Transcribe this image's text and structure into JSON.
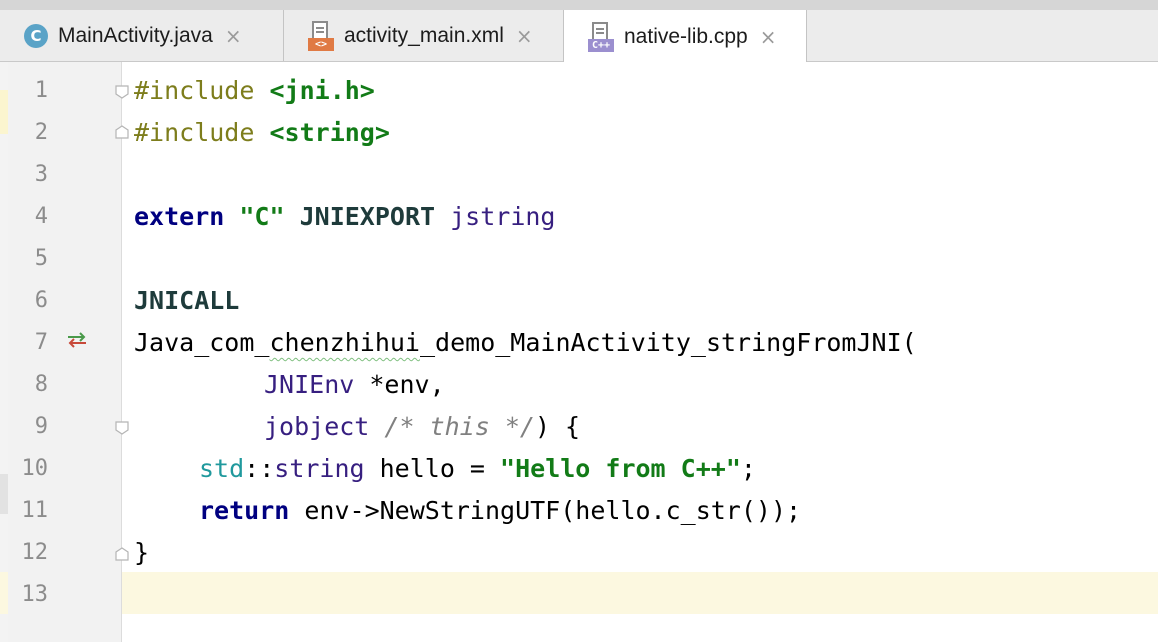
{
  "tabs": [
    {
      "label": "MainActivity.java",
      "icon": "java-class-icon",
      "icon_letter": "C",
      "active": false
    },
    {
      "label": "activity_main.xml",
      "icon": "xml-file-icon",
      "icon_badge": "<>",
      "active": false
    },
    {
      "label": "native-lib.cpp",
      "icon": "cpp-file-icon",
      "icon_badge": "C++",
      "active": true
    }
  ],
  "close_glyph": "×",
  "editor": {
    "line_numbers": [
      "1",
      "2",
      "3",
      "4",
      "5",
      "6",
      "7",
      "8",
      "9",
      "10",
      "11",
      "12",
      "13"
    ],
    "current_line": "13",
    "gutter_icon_line7": "⇆",
    "code": {
      "l1": {
        "pre": "#include",
        "arg": "<jni.h>"
      },
      "l2": {
        "pre": "#include",
        "arg": "<string>"
      },
      "l4": {
        "kw": "extern",
        "str": "\"C\"",
        "macro": "JNIEXPORT",
        "type": "jstring"
      },
      "l6": {
        "macro": "JNICALL"
      },
      "l7": {
        "a": "Java_com_",
        "b": "chenzhihui",
        "c": "_demo_MainActivity_stringFromJNI("
      },
      "l8": {
        "type": "JNIEnv",
        "rest": " *env,"
      },
      "l9": {
        "type": "jobject",
        "cmt_a": "/* ",
        "cmt_b": "this",
        "cmt_c": " */",
        "rest": ") {"
      },
      "l10": {
        "ns": "std",
        "sep": "::",
        "type": "string",
        "mid": " hello = ",
        "str": "\"Hello from C++\"",
        "end": ";"
      },
      "l11": {
        "kw": "return",
        "rest": " env->NewStringUTF(hello.c_str());"
      },
      "l12": {
        "brace": "}"
      }
    }
  },
  "colors": {
    "tab_bar": "#ececec",
    "gutter": "#f2f2f2",
    "current_line": "#fcf8e0",
    "keyword": "#000080",
    "string": "#127b17",
    "type": "#371f80"
  }
}
